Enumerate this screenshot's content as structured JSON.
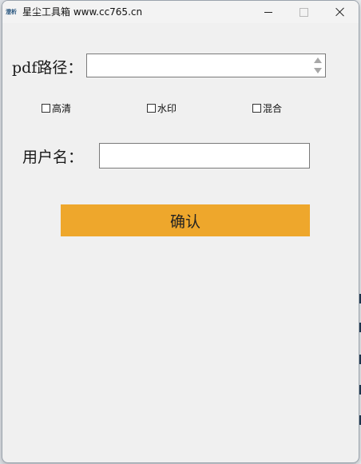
{
  "window": {
    "title": "星尘工具箱 www.cc765.cn",
    "icon_label": "澄析"
  },
  "form": {
    "pdf_label": "pdf路径：",
    "pdf_value": "",
    "options": [
      {
        "label": "高清",
        "checked": false
      },
      {
        "label": "水印",
        "checked": false
      },
      {
        "label": "混合",
        "checked": false
      }
    ],
    "username_label": "用户名：",
    "username_value": "",
    "confirm_label": "确认"
  },
  "colors": {
    "button_bg": "#eea72c",
    "window_bg": "#f0f0f0"
  }
}
